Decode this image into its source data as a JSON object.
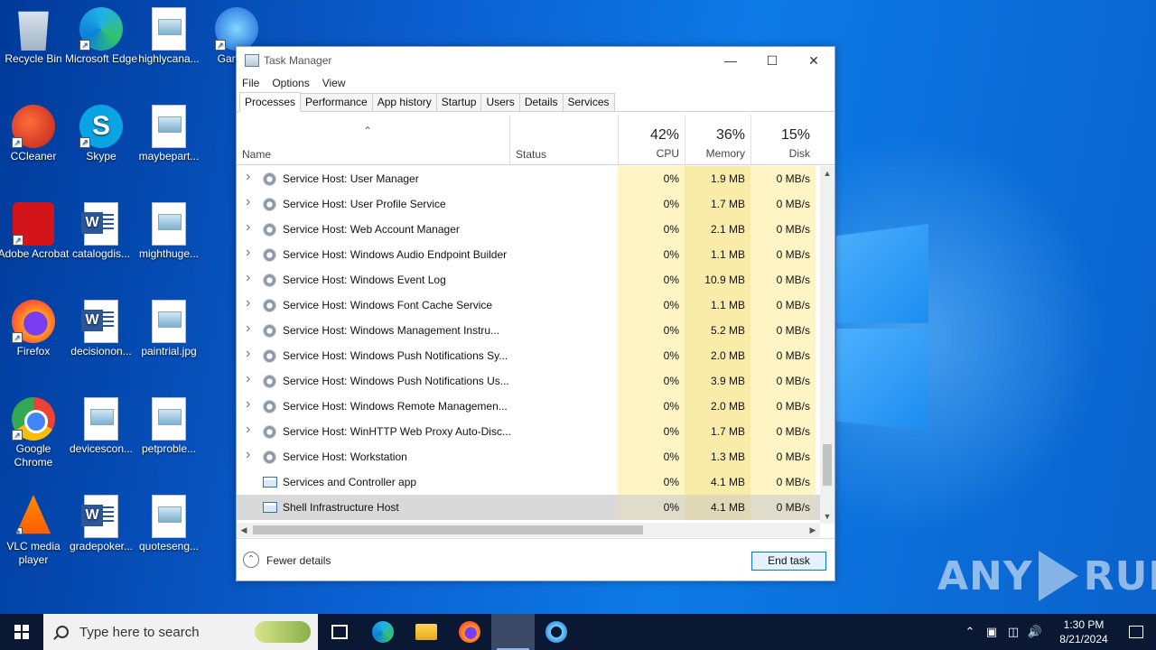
{
  "desktop": {
    "icons": [
      {
        "label": "Recycle Bin",
        "icon": "recycle-bin-icon"
      },
      {
        "label": "Microsoft Edge",
        "icon": "edge-icon"
      },
      {
        "label": "highlycana...",
        "icon": "image-file-icon"
      },
      {
        "label": "Game...",
        "icon": "gamer-icon"
      },
      {
        "label": "CCleaner",
        "icon": "ccleaner-icon"
      },
      {
        "label": "Skype",
        "icon": "skype-icon"
      },
      {
        "label": "maybepart...",
        "icon": "image-file-icon"
      },
      {
        "label": "Adobe Acrobat",
        "icon": "acrobat-icon"
      },
      {
        "label": "catalogdis...",
        "icon": "word-doc-icon"
      },
      {
        "label": "mighthuge...",
        "icon": "image-file-icon"
      },
      {
        "label": "Firefox",
        "icon": "firefox-icon"
      },
      {
        "label": "decisionon...",
        "icon": "word-doc-icon"
      },
      {
        "label": "paintrial.jpg",
        "icon": "image-file-icon"
      },
      {
        "label": "Google Chrome",
        "icon": "chrome-icon"
      },
      {
        "label": "devicescon...",
        "icon": "image-file-icon"
      },
      {
        "label": "petproble...",
        "icon": "image-file-icon"
      },
      {
        "label": "VLC media player",
        "icon": "vlc-icon"
      },
      {
        "label": "gradepoker...",
        "icon": "word-doc-icon"
      },
      {
        "label": "quoteseng...",
        "icon": "image-file-icon"
      }
    ],
    "watermark": "ANY RUN"
  },
  "taskmanager": {
    "title": "Task Manager",
    "menu": [
      "File",
      "Options",
      "View"
    ],
    "tabs": [
      "Processes",
      "Performance",
      "App history",
      "Startup",
      "Users",
      "Details",
      "Services"
    ],
    "active_tab": "Processes",
    "header": {
      "name": "Name",
      "status": "Status",
      "cpu_pct": "42%",
      "cpu_label": "CPU",
      "mem_pct": "36%",
      "mem_label": "Memory",
      "disk_pct": "15%",
      "disk_label": "Disk"
    },
    "rows": [
      {
        "name": "Service Host: User Manager",
        "cpu": "0%",
        "mem": "1.9 MB",
        "disk": "0 MB/s",
        "icon": "gear-icon",
        "expandable": true
      },
      {
        "name": "Service Host: User Profile Service",
        "cpu": "0%",
        "mem": "1.7 MB",
        "disk": "0 MB/s",
        "icon": "gear-icon",
        "expandable": true
      },
      {
        "name": "Service Host: Web Account Manager",
        "cpu": "0%",
        "mem": "2.1 MB",
        "disk": "0 MB/s",
        "icon": "gear-icon",
        "expandable": true
      },
      {
        "name": "Service Host: Windows Audio Endpoint Builder",
        "cpu": "0%",
        "mem": "1.1 MB",
        "disk": "0 MB/s",
        "icon": "gear-icon",
        "expandable": true
      },
      {
        "name": "Service Host: Windows Event Log",
        "cpu": "0%",
        "mem": "10.9 MB",
        "disk": "0 MB/s",
        "icon": "gear-icon",
        "expandable": true
      },
      {
        "name": "Service Host: Windows Font Cache Service",
        "cpu": "0%",
        "mem": "1.1 MB",
        "disk": "0 MB/s",
        "icon": "gear-icon",
        "expandable": true
      },
      {
        "name": "Service Host: Windows Management Instru...",
        "cpu": "0%",
        "mem": "5.2 MB",
        "disk": "0 MB/s",
        "icon": "gear-icon",
        "expandable": true
      },
      {
        "name": "Service Host: Windows Push Notifications Sy...",
        "cpu": "0%",
        "mem": "2.0 MB",
        "disk": "0 MB/s",
        "icon": "gear-icon",
        "expandable": true
      },
      {
        "name": "Service Host: Windows Push Notifications Us...",
        "cpu": "0%",
        "mem": "3.9 MB",
        "disk": "0 MB/s",
        "icon": "gear-icon",
        "expandable": true
      },
      {
        "name": "Service Host: Windows Remote Managemen...",
        "cpu": "0%",
        "mem": "2.0 MB",
        "disk": "0 MB/s",
        "icon": "gear-icon",
        "expandable": true
      },
      {
        "name": "Service Host: WinHTTP Web Proxy Auto-Disc...",
        "cpu": "0%",
        "mem": "1.7 MB",
        "disk": "0 MB/s",
        "icon": "gear-icon",
        "expandable": true
      },
      {
        "name": "Service Host: Workstation",
        "cpu": "0%",
        "mem": "1.3 MB",
        "disk": "0 MB/s",
        "icon": "gear-icon",
        "expandable": true
      },
      {
        "name": "Services and Controller app",
        "cpu": "0%",
        "mem": "4.1 MB",
        "disk": "0 MB/s",
        "icon": "app-window-icon",
        "expandable": false
      },
      {
        "name": "Shell Infrastructure Host",
        "cpu": "0%",
        "mem": "4.1 MB",
        "disk": "0 MB/s",
        "icon": "app-window-icon",
        "expandable": false,
        "selected": true
      }
    ],
    "fewer_details": "Fewer details",
    "end_task": "End task"
  },
  "taskbar": {
    "search_placeholder": "Type here to search",
    "time": "1:30 PM",
    "date": "8/21/2024"
  }
}
